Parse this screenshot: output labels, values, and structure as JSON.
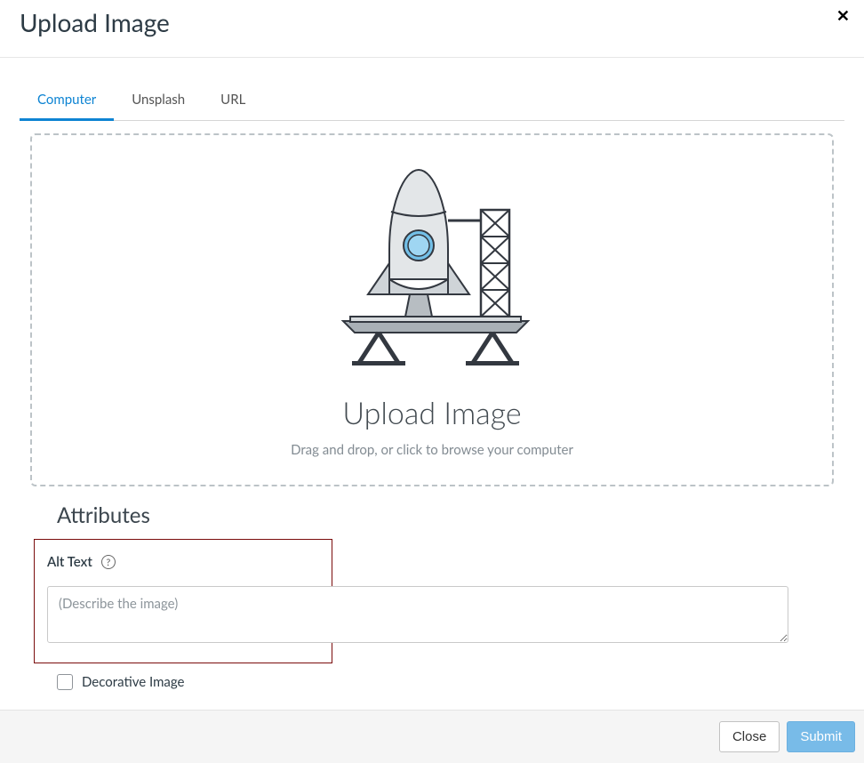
{
  "header": {
    "title": "Upload Image",
    "close_glyph": "✕"
  },
  "tabs": [
    {
      "label": "Computer",
      "active": true
    },
    {
      "label": "Unsplash",
      "active": false
    },
    {
      "label": "URL",
      "active": false
    }
  ],
  "dropzone": {
    "title": "Upload Image",
    "subtitle": "Drag and drop, or click to browse your computer"
  },
  "attributes": {
    "heading": "Attributes",
    "alt_label": "Alt Text",
    "alt_placeholder": "(Describe the image)",
    "alt_value": "",
    "decorative_label": "Decorative Image",
    "decorative_checked": false,
    "help_glyph": "?"
  },
  "footer": {
    "close_label": "Close",
    "submit_label": "Submit"
  }
}
